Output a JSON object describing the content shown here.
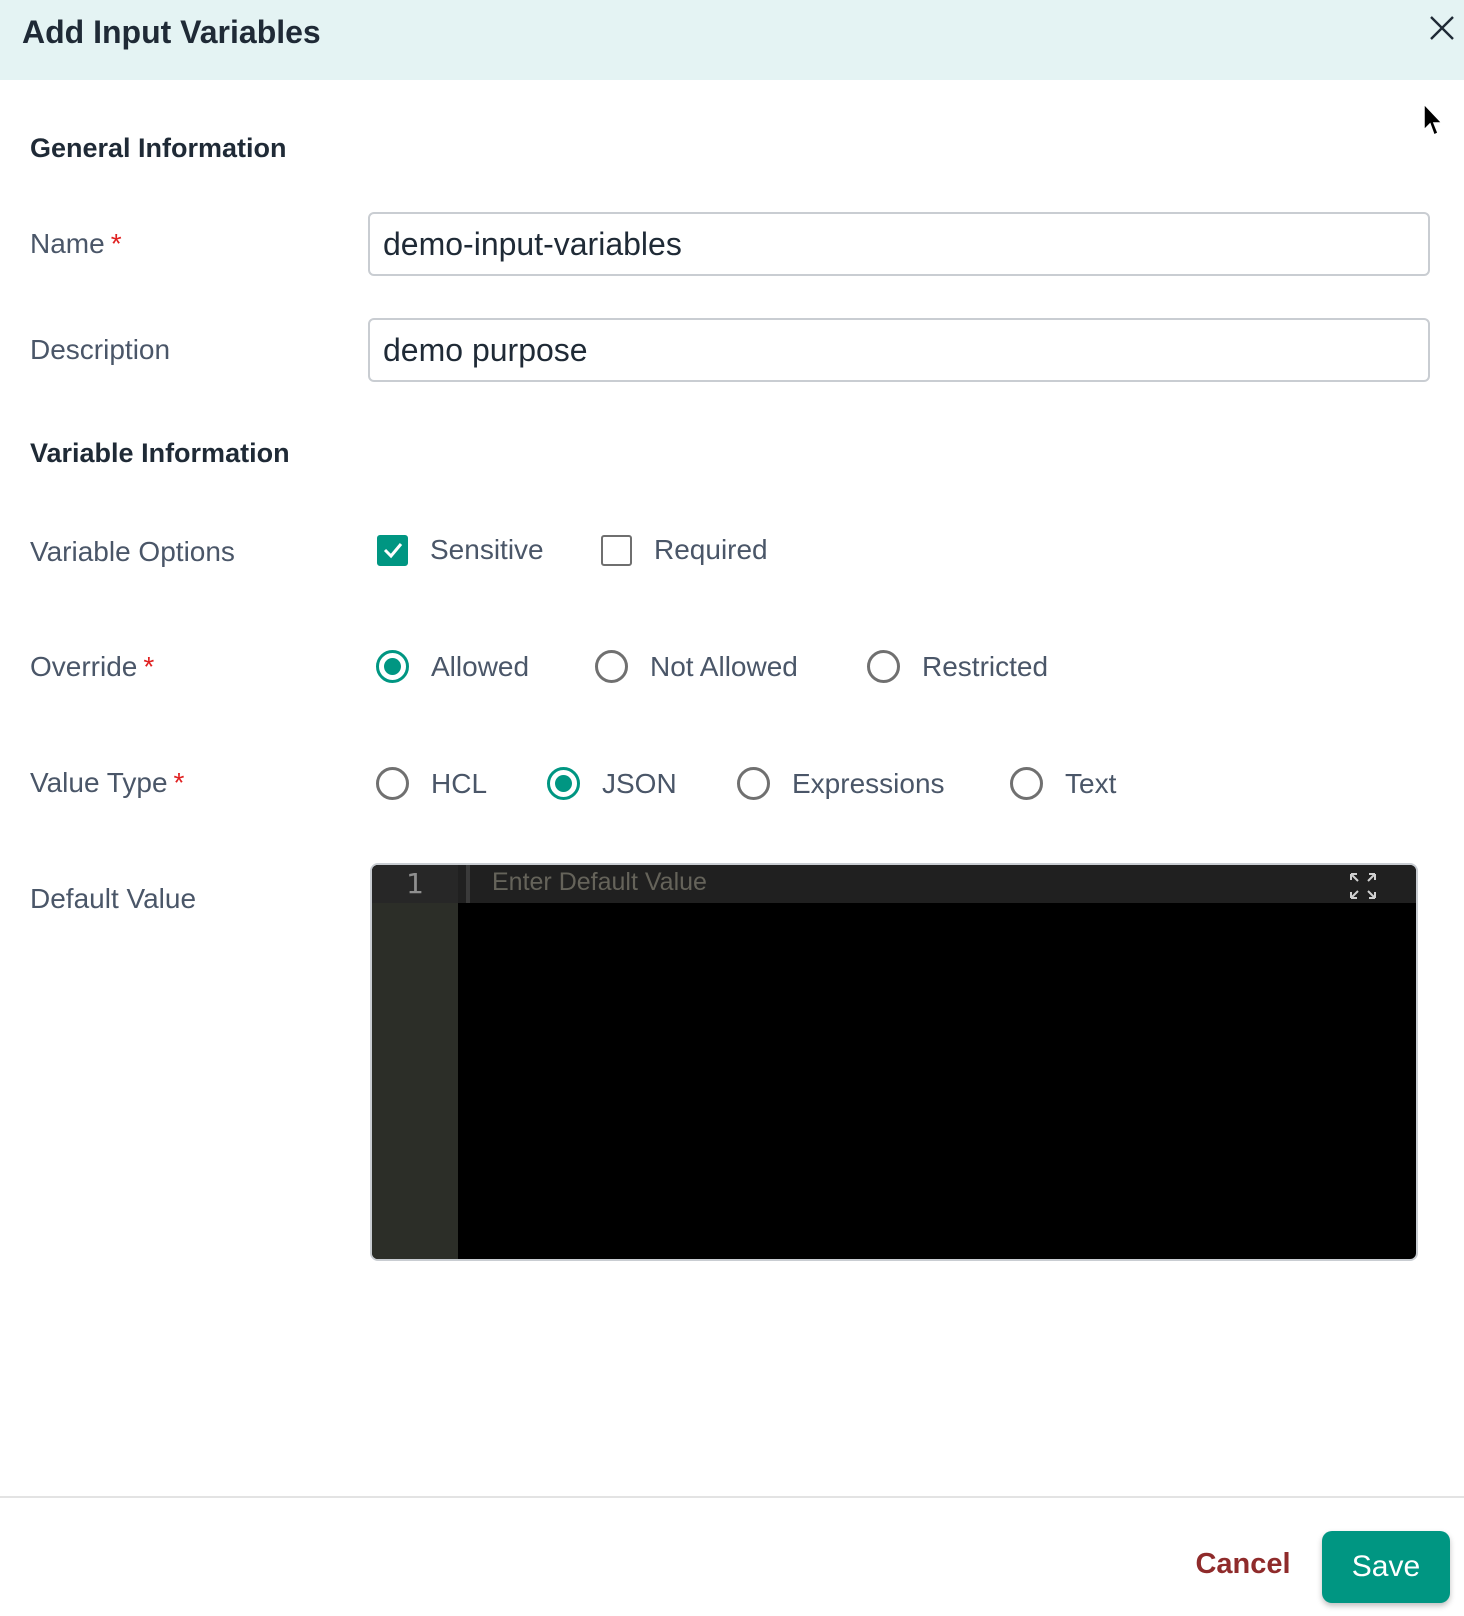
{
  "dialog": {
    "title": "Add Input Variables",
    "close_icon": "close-icon"
  },
  "general_section": {
    "title": "General Information",
    "name": {
      "label": "Name",
      "required_marker": "*",
      "value": "demo-input-variables"
    },
    "description": {
      "label": "Description",
      "value": "demo purpose"
    }
  },
  "variable_section": {
    "title": "Variable Information",
    "variable_options": {
      "label": "Variable Options",
      "options": [
        {
          "label": "Sensitive",
          "checked": true
        },
        {
          "label": "Required",
          "checked": false
        }
      ]
    },
    "override": {
      "label": "Override",
      "required_marker": "*",
      "options": [
        {
          "label": "Allowed",
          "selected": true
        },
        {
          "label": "Not Allowed",
          "selected": false
        },
        {
          "label": "Restricted",
          "selected": false
        }
      ]
    },
    "value_type": {
      "label": "Value Type",
      "required_marker": "*",
      "options": [
        {
          "label": "HCL",
          "selected": false
        },
        {
          "label": "JSON",
          "selected": true
        },
        {
          "label": "Expressions",
          "selected": false
        },
        {
          "label": "Text",
          "selected": false
        }
      ]
    },
    "default_value": {
      "label": "Default Value",
      "line_number": "1",
      "placeholder": "Enter Default Value",
      "expand_icon": "expand-icon"
    }
  },
  "footer": {
    "cancel_label": "Cancel",
    "save_label": "Save"
  },
  "colors": {
    "accent": "#009682",
    "header_bg": "#e4f3f3",
    "required": "#e02020",
    "cancel": "#8f2b2b"
  }
}
